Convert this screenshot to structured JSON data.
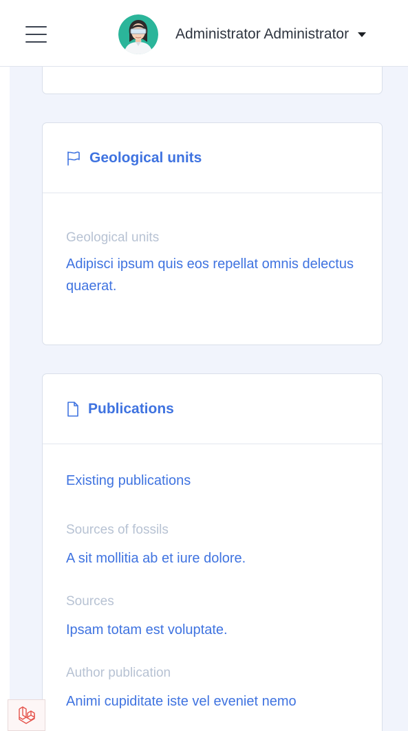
{
  "header": {
    "menu_icon": "hamburger-icon",
    "user_name": "Administrator Administrator",
    "dropdown_icon": "caret-down-icon"
  },
  "geological_units": {
    "icon": "flag-icon",
    "title": "Geological units",
    "label": "Geological units",
    "value": "Adipisci ipsum quis eos repellat omnis delectus quaerat."
  },
  "publications": {
    "icon": "file-icon",
    "title": "Publications",
    "existing_link": "Existing publications",
    "fields": [
      {
        "label": "Sources of fossils",
        "value": "A sit mollitia ab et iure dolore."
      },
      {
        "label": "Sources",
        "value": "Ipsam totam est voluptate."
      },
      {
        "label": "Author publication",
        "value": "Animi cupiditate iste vel eveniet nemo"
      }
    ]
  },
  "footer": {
    "badge_icon": "laravel-logo-icon"
  },
  "colors": {
    "accent": "#3f73e0",
    "muted_label": "#b7c2d3",
    "background": "#f1f4fc"
  }
}
